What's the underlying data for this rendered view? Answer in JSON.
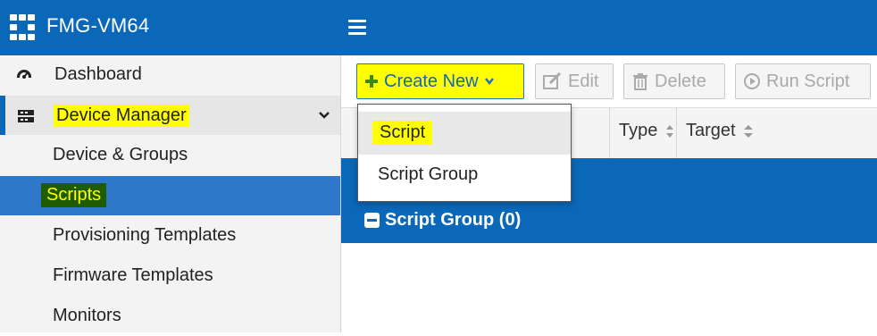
{
  "header": {
    "app_title": "FMG-VM64",
    "logo_icon": "fortinet-logo-icon",
    "menu_icon": "hamburger-menu-icon"
  },
  "sidebar": {
    "items": [
      {
        "label": "Dashboard",
        "icon": "dashboard-gauge-icon"
      },
      {
        "label": "Device Manager",
        "icon": "device-manager-icon",
        "expanded": true
      },
      {
        "label": "Device & Groups"
      },
      {
        "label": "Scripts",
        "selected": true
      },
      {
        "label": "Provisioning Templates"
      },
      {
        "label": "Firmware Templates"
      },
      {
        "label": "Monitors"
      }
    ]
  },
  "toolbar": {
    "create_new": "Create New",
    "edit": "Edit",
    "delete": "Delete",
    "run_script": "Run Script"
  },
  "grid": {
    "columns": [
      "Type",
      "Target"
    ],
    "group_label": "Script Group (0)"
  },
  "dropdown": {
    "items": [
      "Script",
      "Script Group"
    ]
  },
  "colors": {
    "brand_blue": "#0b67b7",
    "highlight_yellow": "#ffff00",
    "selected_blue": "#2f77c8"
  }
}
